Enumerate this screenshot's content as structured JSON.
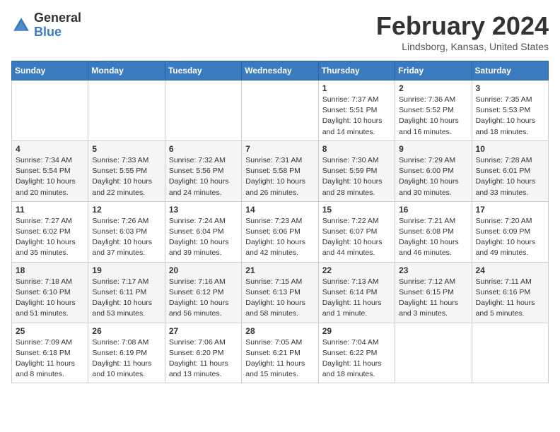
{
  "header": {
    "logo": {
      "general": "General",
      "blue": "Blue"
    },
    "title": "February 2024",
    "location": "Lindsborg, Kansas, United States"
  },
  "calendar": {
    "days_of_week": [
      "Sunday",
      "Monday",
      "Tuesday",
      "Wednesday",
      "Thursday",
      "Friday",
      "Saturday"
    ],
    "weeks": [
      [
        {
          "day": "",
          "info": ""
        },
        {
          "day": "",
          "info": ""
        },
        {
          "day": "",
          "info": ""
        },
        {
          "day": "",
          "info": ""
        },
        {
          "day": "1",
          "info": "Sunrise: 7:37 AM\nSunset: 5:51 PM\nDaylight: 10 hours\nand 14 minutes."
        },
        {
          "day": "2",
          "info": "Sunrise: 7:36 AM\nSunset: 5:52 PM\nDaylight: 10 hours\nand 16 minutes."
        },
        {
          "day": "3",
          "info": "Sunrise: 7:35 AM\nSunset: 5:53 PM\nDaylight: 10 hours\nand 18 minutes."
        }
      ],
      [
        {
          "day": "4",
          "info": "Sunrise: 7:34 AM\nSunset: 5:54 PM\nDaylight: 10 hours\nand 20 minutes."
        },
        {
          "day": "5",
          "info": "Sunrise: 7:33 AM\nSunset: 5:55 PM\nDaylight: 10 hours\nand 22 minutes."
        },
        {
          "day": "6",
          "info": "Sunrise: 7:32 AM\nSunset: 5:56 PM\nDaylight: 10 hours\nand 24 minutes."
        },
        {
          "day": "7",
          "info": "Sunrise: 7:31 AM\nSunset: 5:58 PM\nDaylight: 10 hours\nand 26 minutes."
        },
        {
          "day": "8",
          "info": "Sunrise: 7:30 AM\nSunset: 5:59 PM\nDaylight: 10 hours\nand 28 minutes."
        },
        {
          "day": "9",
          "info": "Sunrise: 7:29 AM\nSunset: 6:00 PM\nDaylight: 10 hours\nand 30 minutes."
        },
        {
          "day": "10",
          "info": "Sunrise: 7:28 AM\nSunset: 6:01 PM\nDaylight: 10 hours\nand 33 minutes."
        }
      ],
      [
        {
          "day": "11",
          "info": "Sunrise: 7:27 AM\nSunset: 6:02 PM\nDaylight: 10 hours\nand 35 minutes."
        },
        {
          "day": "12",
          "info": "Sunrise: 7:26 AM\nSunset: 6:03 PM\nDaylight: 10 hours\nand 37 minutes."
        },
        {
          "day": "13",
          "info": "Sunrise: 7:24 AM\nSunset: 6:04 PM\nDaylight: 10 hours\nand 39 minutes."
        },
        {
          "day": "14",
          "info": "Sunrise: 7:23 AM\nSunset: 6:06 PM\nDaylight: 10 hours\nand 42 minutes."
        },
        {
          "day": "15",
          "info": "Sunrise: 7:22 AM\nSunset: 6:07 PM\nDaylight: 10 hours\nand 44 minutes."
        },
        {
          "day": "16",
          "info": "Sunrise: 7:21 AM\nSunset: 6:08 PM\nDaylight: 10 hours\nand 46 minutes."
        },
        {
          "day": "17",
          "info": "Sunrise: 7:20 AM\nSunset: 6:09 PM\nDaylight: 10 hours\nand 49 minutes."
        }
      ],
      [
        {
          "day": "18",
          "info": "Sunrise: 7:18 AM\nSunset: 6:10 PM\nDaylight: 10 hours\nand 51 minutes."
        },
        {
          "day": "19",
          "info": "Sunrise: 7:17 AM\nSunset: 6:11 PM\nDaylight: 10 hours\nand 53 minutes."
        },
        {
          "day": "20",
          "info": "Sunrise: 7:16 AM\nSunset: 6:12 PM\nDaylight: 10 hours\nand 56 minutes."
        },
        {
          "day": "21",
          "info": "Sunrise: 7:15 AM\nSunset: 6:13 PM\nDaylight: 10 hours\nand 58 minutes."
        },
        {
          "day": "22",
          "info": "Sunrise: 7:13 AM\nSunset: 6:14 PM\nDaylight: 11 hours\nand 1 minute."
        },
        {
          "day": "23",
          "info": "Sunrise: 7:12 AM\nSunset: 6:15 PM\nDaylight: 11 hours\nand 3 minutes."
        },
        {
          "day": "24",
          "info": "Sunrise: 7:11 AM\nSunset: 6:16 PM\nDaylight: 11 hours\nand 5 minutes."
        }
      ],
      [
        {
          "day": "25",
          "info": "Sunrise: 7:09 AM\nSunset: 6:18 PM\nDaylight: 11 hours\nand 8 minutes."
        },
        {
          "day": "26",
          "info": "Sunrise: 7:08 AM\nSunset: 6:19 PM\nDaylight: 11 hours\nand 10 minutes."
        },
        {
          "day": "27",
          "info": "Sunrise: 7:06 AM\nSunset: 6:20 PM\nDaylight: 11 hours\nand 13 minutes."
        },
        {
          "day": "28",
          "info": "Sunrise: 7:05 AM\nSunset: 6:21 PM\nDaylight: 11 hours\nand 15 minutes."
        },
        {
          "day": "29",
          "info": "Sunrise: 7:04 AM\nSunset: 6:22 PM\nDaylight: 11 hours\nand 18 minutes."
        },
        {
          "day": "",
          "info": ""
        },
        {
          "day": "",
          "info": ""
        }
      ]
    ]
  }
}
